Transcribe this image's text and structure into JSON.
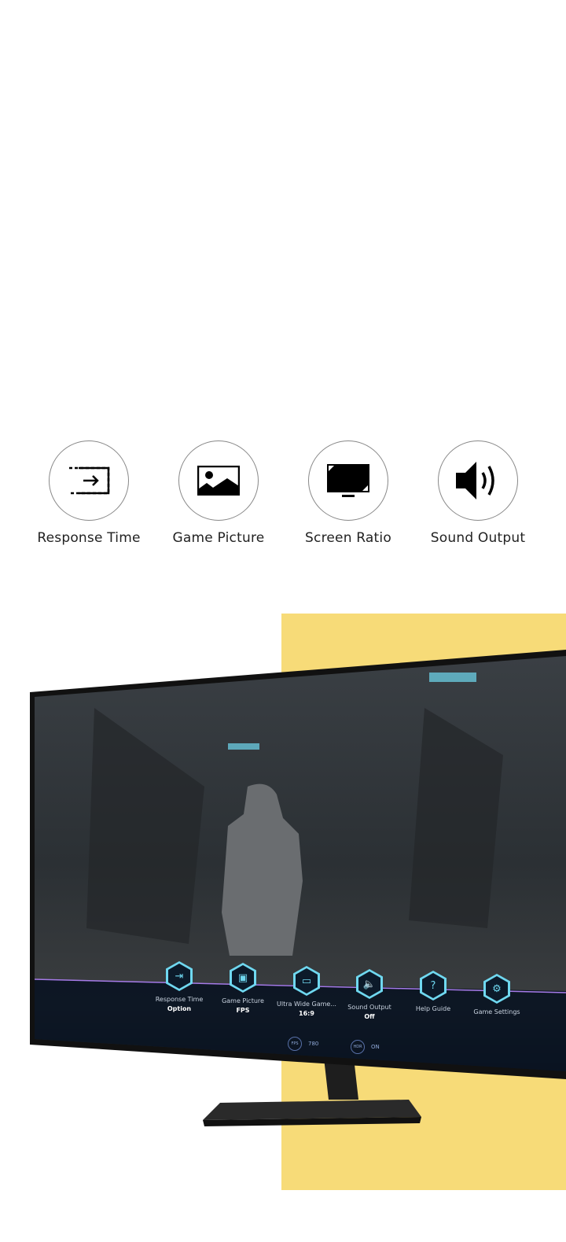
{
  "features": [
    {
      "label": "Response Time",
      "icon": "response-time-icon"
    },
    {
      "label": "Game Picture",
      "icon": "picture-icon"
    },
    {
      "label": "Screen Ratio",
      "icon": "monitor-icon"
    },
    {
      "label": "Sound Output",
      "icon": "speaker-icon"
    }
  ],
  "game_bar": {
    "items": [
      {
        "label": "Response Time",
        "value": "Option",
        "icon": "response-time-icon"
      },
      {
        "label": "Game Picture",
        "value": "FPS",
        "icon": "picture-icon"
      },
      {
        "label": "Ultra Wide Game...",
        "value": "16:9",
        "icon": "monitor-icon"
      },
      {
        "label": "Sound Output",
        "value": "Off",
        "icon": "speaker-icon"
      },
      {
        "label": "Help Guide",
        "icon": "help-icon"
      },
      {
        "label": "Game Settings",
        "icon": "gear-icon"
      }
    ],
    "stats": [
      {
        "badge": "FPS",
        "value": "780"
      },
      {
        "badge": "HDR",
        "value": "ON"
      }
    ]
  },
  "colors": {
    "accent_yellow": "#f7db78",
    "hud_cyan": "#6fd8f0"
  }
}
